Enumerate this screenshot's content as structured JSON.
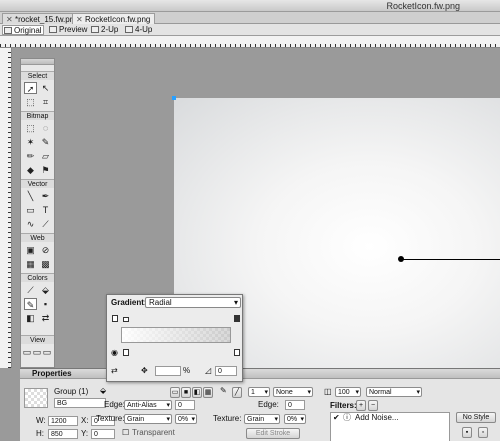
{
  "window": {
    "title": "RocketIcon.fw.png"
  },
  "tabs": [
    {
      "label": "*rocket_15.fw.png"
    },
    {
      "label": "RocketIcon.fw.png"
    }
  ],
  "viewbar": {
    "original": "Original",
    "preview": "Preview",
    "two_up": "2-Up",
    "four_up": "4-Up"
  },
  "tools": {
    "sections": [
      "Select",
      "Bitmap",
      "Vector",
      "Web",
      "Colors",
      "View"
    ],
    "text_tool": "T"
  },
  "gradient_popup": {
    "label": "Gradient:",
    "type": "Radial",
    "percent_symbol": "%",
    "angle_value": "0"
  },
  "properties": {
    "title": "Properties",
    "object_label": "Group (1)",
    "name_value": "BG",
    "w_label": "W:",
    "w_value": "1200",
    "x_label": "X:",
    "x_value": "0",
    "h_label": "H:",
    "h_value": "850",
    "y_label": "Y:",
    "y_value": "0",
    "fill_edge_label": "Edge:",
    "fill_edge_value": "Anti-Alias",
    "fill_edge_amount": "0",
    "fill_texture_label": "Texture:",
    "fill_texture_value": "Grain",
    "fill_texture_amount": "0%",
    "transparent_label": "Transparent",
    "stroke_size": "1",
    "stroke_type": "None",
    "stroke_edge_label": "Edge:",
    "stroke_edge_amount": "0",
    "stroke_texture_label": "Texture:",
    "stroke_texture_value": "Grain",
    "stroke_texture_amount": "0%",
    "edit_stroke": "Edit Stroke",
    "opacity": "100",
    "blend_mode": "Normal",
    "filters_label": "Filters:",
    "filter_item": "Add Noise...",
    "style_label": "No Style"
  }
}
